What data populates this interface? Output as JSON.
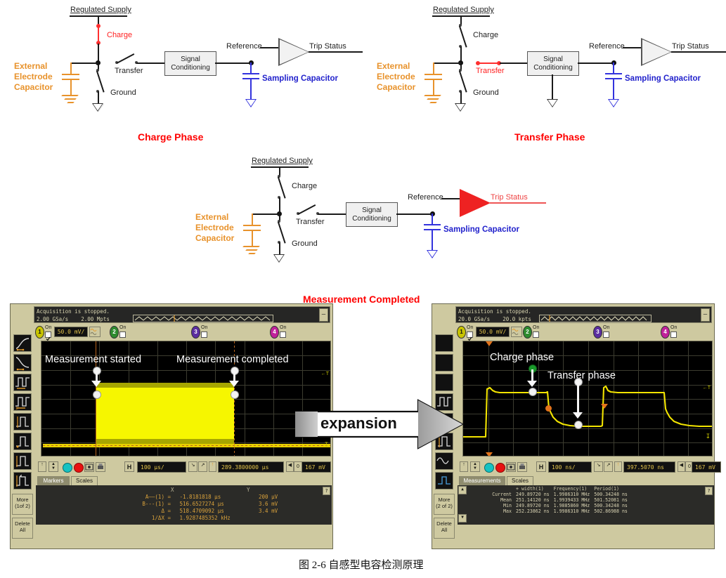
{
  "figure": {
    "caption": "图 2-6 自感型电容检测原理"
  },
  "colors": {
    "red": "#FF0000",
    "orange": "#E8922B",
    "blue": "#2222CC",
    "scope_panel": "#CEC9A0",
    "scope_screen": "#000000",
    "trace_yellow": "#E8E800",
    "readout_amber": "#D8A13B"
  },
  "diagrams": [
    {
      "id": "charge-phase",
      "title": "Charge Phase",
      "supply_label": "Regulated Supply",
      "charge_label": "Charge",
      "transfer_label": "Transfer",
      "ground_label": "Ground",
      "external_cap_label": "External\nElectrode\nCapacitor",
      "external_cap_lines": [
        "External",
        "Electrode",
        "Capacitor"
      ],
      "signal_box": [
        "Signal",
        "Conditioning"
      ],
      "reference_label": "Reference",
      "trip_status_label": "Trip Status",
      "sampling_cap_label": "Sampling Capacitor",
      "active_switch": "charge"
    },
    {
      "id": "transfer-phase",
      "title": "Transfer Phase",
      "supply_label": "Regulated Supply",
      "charge_label": "Charge",
      "transfer_label": "Transfer",
      "ground_label": "Ground",
      "external_cap_lines": [
        "External",
        "Electrode",
        "Capacitor"
      ],
      "signal_box": [
        "Signal",
        "Conditioning"
      ],
      "reference_label": "Reference",
      "trip_status_label": "Trip Status",
      "sampling_cap_label": "Sampling Capacitor",
      "active_switch": "transfer"
    },
    {
      "id": "measurement-completed",
      "title": "Measurement Completed",
      "supply_label": "Regulated Supply",
      "charge_label": "Charge",
      "transfer_label": "Transfer",
      "ground_label": "Ground",
      "external_cap_lines": [
        "External",
        "Electrode",
        "Capacitor"
      ],
      "signal_box": [
        "Signal",
        "Conditioning"
      ],
      "reference_label": "Reference",
      "trip_status_label": "Trip Status",
      "sampling_cap_label": "Sampling Capacitor",
      "active_switch": "none"
    }
  ],
  "expansion": {
    "label": "expansion"
  },
  "scope_left": {
    "status_line1": "Acquisition is stopped.",
    "sample_rate": "2.00 GSa/s",
    "memory": "2.00 Mpts",
    "minimize_label": "–",
    "channels": [
      {
        "num": "1",
        "on_label": "On",
        "checked": true,
        "scale": "50.0 mV/"
      },
      {
        "num": "2",
        "on_label": "On",
        "checked": false,
        "scale": ""
      },
      {
        "num": "3",
        "on_label": "On",
        "checked": false,
        "scale": ""
      },
      {
        "num": "4",
        "on_label": "On",
        "checked": false,
        "scale": ""
      }
    ],
    "annotations": [
      {
        "text": "Measurement started"
      },
      {
        "text": "Measurement completed"
      }
    ],
    "timebase": "100 µs/",
    "delay": "289.3800000 µs",
    "delay_steps": "0",
    "trigger_level": "167 mV",
    "horiz_icon_label": "H",
    "trig_icon_label": "T",
    "sidebar_buttons": [
      {
        "label": "More\n(1of 2)",
        "line1": "More",
        "line2": "(1of 2)"
      },
      {
        "label": "Delete All",
        "line1": "Delete",
        "line2": "All"
      }
    ],
    "tabs": [
      {
        "label": "Markers",
        "selected": true
      },
      {
        "label": "Scales",
        "selected": false
      }
    ],
    "help_label": "?",
    "markers": {
      "col_x": "X",
      "col_y": "Y",
      "rows": [
        {
          "name": "A——(1) =",
          "x": "-1.8181818 µs",
          "y": "200 µV"
        },
        {
          "name": "B---(1) =",
          "x": "516.6527274 µs",
          "y": "3.6 mV"
        },
        {
          "name": "Δ =",
          "x": "518.4709092 µs",
          "y": "3.4 mV"
        },
        {
          "name": "1/ΔX =",
          "x": "1.9287485352 kHz",
          "y": ""
        }
      ]
    }
  },
  "scope_right": {
    "status_line1": "Acquisition is stopped.",
    "sample_rate": "20.0 GSa/s",
    "memory": "20.0 kpts",
    "minimize_label": "–",
    "channels": [
      {
        "num": "1",
        "on_label": "On",
        "checked": true,
        "scale": "50.0 mV/"
      },
      {
        "num": "2",
        "on_label": "On",
        "checked": false,
        "scale": ""
      },
      {
        "num": "3",
        "on_label": "On",
        "checked": false,
        "scale": ""
      },
      {
        "num": "4",
        "on_label": "On",
        "checked": false,
        "scale": ""
      }
    ],
    "annotations": [
      {
        "text": "Charge phase"
      },
      {
        "text": "Transfer phase"
      }
    ],
    "timebase": "100 ns/",
    "delay": "397.5070 ns",
    "delay_steps": "0",
    "trigger_level": "167 mV",
    "horiz_icon_label": "H",
    "trig_icon_label": "T",
    "sidebar_buttons": [
      {
        "line1": "More",
        "line2": "(2 of 2)"
      },
      {
        "line1": "Delete",
        "line2": "All"
      }
    ],
    "tabs": [
      {
        "label": "Measurements",
        "selected": true
      },
      {
        "label": "Scales",
        "selected": false
      }
    ],
    "help_label": "?",
    "measurements": {
      "columns": [
        "",
        "+ width(1)",
        "Frequency(1)",
        "Period(1)"
      ],
      "rows": [
        {
          "label": "Current",
          "width": "249.89720 ns",
          "freq": "1.9986310 MHz",
          "period": "500.34248 ns"
        },
        {
          "label": "Mean",
          "width": "251.14120 ns",
          "freq": "1.9939433 MHz",
          "period": "501.52081 ns"
        },
        {
          "label": "Min",
          "width": "249.89720 ns",
          "freq": "1.9885860 MHz",
          "period": "500.34248 ns"
        },
        {
          "label": "Max",
          "width": "252.23862 ns",
          "freq": "1.9986310 MHz",
          "period": "502.86988 ns"
        }
      ]
    }
  }
}
